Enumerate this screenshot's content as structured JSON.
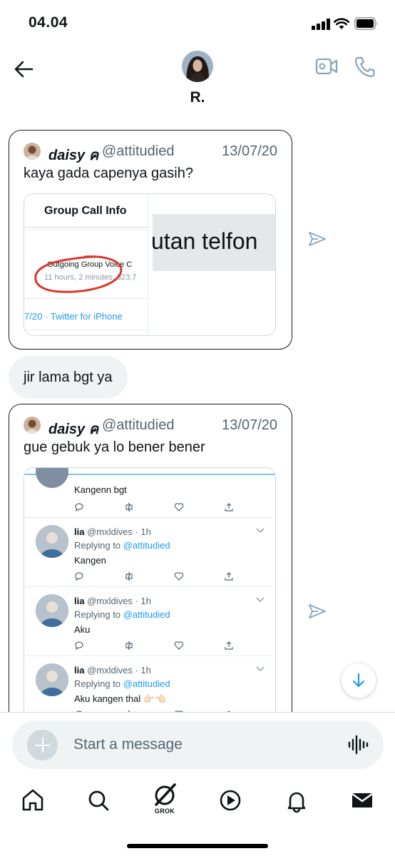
{
  "status_bar": {
    "time": "04.04"
  },
  "header": {
    "contact_name": "R."
  },
  "messages": {
    "tweet1": {
      "author_name": "daisy ค",
      "handle": "@attitudied",
      "date": "13/07/20",
      "text": "kaya gada capenya gasih?",
      "embed": {
        "title": "Group Call Info",
        "call_label": "Outgoing Group Voice C",
        "duration": "11 hours, 2 minutes, 323,7",
        "overlay_text": "utan telfon",
        "footer": "7/20 · Twitter for iPhone"
      }
    },
    "bubble": {
      "text": "jir lama bgt ya"
    },
    "tweet2": {
      "author_name": "daisy ค",
      "handle": "@attitudied",
      "date": "13/07/20",
      "text": "gue gebuk ya lo bener bener",
      "embed": {
        "top_reply_text": "Kangenn bgt",
        "replies": [
          {
            "name": "lia",
            "meta": "@mxldives · 1h",
            "replying_prefix": "Replying to ",
            "replying_to": "@attitudied",
            "text": "Kangen"
          },
          {
            "name": "lia",
            "meta": "@mxldives · 1h",
            "replying_prefix": "Replying to ",
            "replying_to": "@attitudied",
            "text": "Aku"
          },
          {
            "name": "lia",
            "meta": "@mxldives · 1h",
            "replying_prefix": "Replying to ",
            "replying_to": "@attitudied",
            "text": "Aku kangen thal 👉🏻👈🏻"
          }
        ]
      }
    }
  },
  "composer": {
    "placeholder": "Start a message"
  },
  "nav": {
    "grok_label": "GROK"
  },
  "icons": {
    "back": "back-arrow-icon",
    "video": "video-call-icon",
    "phone": "phone-icon",
    "share": "send-icon",
    "scroll": "arrow-down-icon",
    "add": "plus-icon",
    "voice": "voice-wave-icon",
    "home": "home-icon",
    "search": "search-icon",
    "grok": "grok-icon",
    "video_tab": "play-icon",
    "notifications": "bell-icon",
    "messages": "mail-icon"
  },
  "colors": {
    "link": "#1d9bf0",
    "secondary_text": "#536471",
    "bubble_bg": "#eff3f4",
    "accent_icon": "#8ba4b8"
  }
}
